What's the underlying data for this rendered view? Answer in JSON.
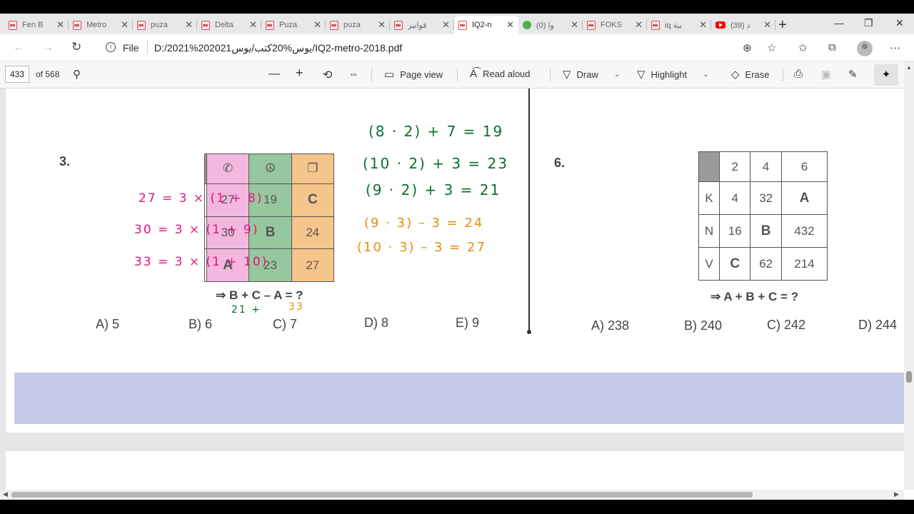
{
  "browser": {
    "tabs": [
      {
        "title": "Fen B",
        "icon": "pdf-icon"
      },
      {
        "title": "Metro",
        "icon": "pdf-icon"
      },
      {
        "title": "puza",
        "icon": "pdf-icon"
      },
      {
        "title": "Delta",
        "icon": "pdf-icon"
      },
      {
        "title": "Puza",
        "icon": "pdf-icon"
      },
      {
        "title": "puza",
        "icon": "pdf-icon"
      },
      {
        "title": "قوانيز",
        "icon": "pdf-icon"
      },
      {
        "title": "IQ2-n",
        "icon": "pdf-icon",
        "active": true
      },
      {
        "title": "(0) وا",
        "icon": "whatsapp-icon"
      },
      {
        "title": "FOKS",
        "icon": "pdf-icon"
      },
      {
        "title": "iq بية",
        "icon": "pdf-icon"
      },
      {
        "title": "(39) د",
        "icon": "youtube-icon"
      }
    ],
    "file_label": "File",
    "url": "D:/2021%202021يوس%20كتب/يوس/IQ2-metro-2018.pdf"
  },
  "pdf_toolbar": {
    "page_current": "433",
    "page_total": "of 568",
    "page_view": "Page view",
    "read_aloud": "Read aloud",
    "draw": "Draw",
    "highlight": "Highlight",
    "erase": "Erase"
  },
  "question3": {
    "number": "3.",
    "header_symbols": [
      "",
      "✆",
      "☮",
      "❐"
    ],
    "rows": [
      [
        "",
        "27",
        "19",
        "C"
      ],
      [
        "",
        "30",
        "B",
        "24"
      ],
      [
        "",
        "A",
        "23",
        "27"
      ]
    ],
    "equation": "⇒ B + C – A = ?",
    "choices": [
      "A) 5",
      "B) 6",
      "C) 7",
      "D) 8",
      "E) 9"
    ]
  },
  "question6": {
    "number": "6.",
    "header": [
      "",
      "2",
      "4",
      "6"
    ],
    "rows": [
      [
        "K",
        "4",
        "32",
        "A"
      ],
      [
        "N",
        "16",
        "B",
        "432"
      ],
      [
        "V",
        "C",
        "62",
        "214"
      ]
    ],
    "equation": "⇒ A + B + C = ?",
    "choices": [
      "A) 238",
      "B) 240",
      "C) 242",
      "D) 244"
    ]
  },
  "handwriting": {
    "green": [
      "(8 · 2) + 7 = 19",
      "(10 · 2) + 3 = 23",
      "(9 · 2) + 3 = 21"
    ],
    "orange": [
      "(9 · 3) – 3 = 24",
      "(10 · 3) – 3 = 27"
    ],
    "pink": [
      "27 = 3 × (1 + 8)",
      "30 = 3 × (1 + 9)",
      "33 = 3 × (1 + 10)"
    ],
    "under_equation_left": "21 +",
    "under_equation_right": "33"
  },
  "colors": {
    "pink_column": "#f4b8e0",
    "green_column": "#97c79f",
    "orange_column": "#f5c58b",
    "band": "#c5c9ea"
  }
}
